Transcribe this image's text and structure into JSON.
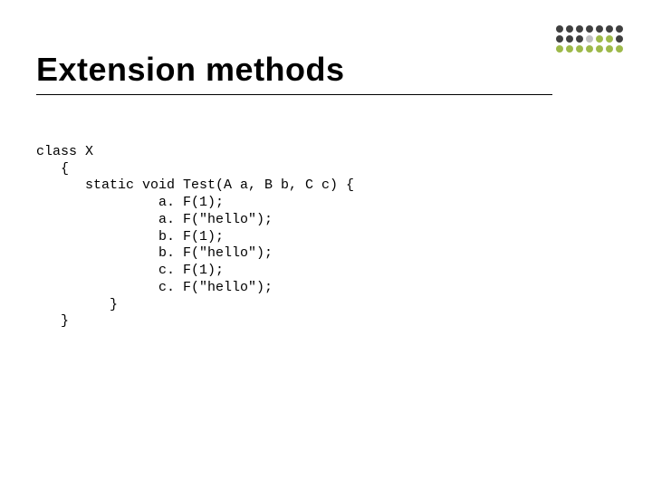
{
  "title": "Extension methods",
  "decor": {
    "dot_rows": 3,
    "dot_cols": 7,
    "dark": "#404040",
    "green": "#9db94a",
    "gray": "#bfbfbf",
    "colors": [
      [
        "dark",
        "dark",
        "dark",
        "dark",
        "dark",
        "dark",
        "dark"
      ],
      [
        "dark",
        "dark",
        "dark",
        "gray",
        "green",
        "green",
        "dark"
      ],
      [
        "green",
        "green",
        "green",
        "green",
        "green",
        "green",
        "green"
      ]
    ]
  },
  "code": {
    "l0": "class X",
    "l1": "   {",
    "l2": "      static void Test(A a, B b, C c) {",
    "l3": "               a. F(1);",
    "l4": "               a. F(\"hello\");",
    "l5": "               b. F(1);",
    "l6": "               b. F(\"hello\");",
    "l7": "               c. F(1);",
    "l8": "               c. F(\"hello\");",
    "l9": "         }",
    "l10": "   }"
  }
}
